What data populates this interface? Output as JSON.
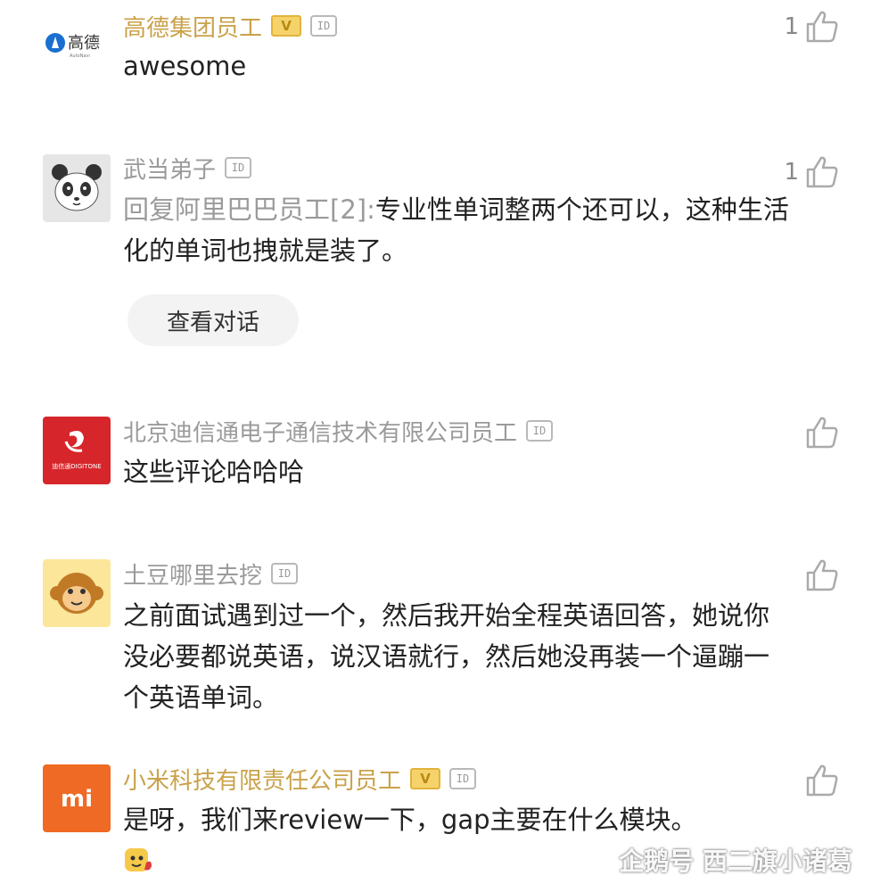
{
  "comments": [
    {
      "username": "高德集团员工",
      "vip_badge": "V",
      "id_badge": "ID",
      "avatar_logo_text": "高德",
      "text": "awesome",
      "likes": "1"
    },
    {
      "username": "武当弟子",
      "id_badge": "ID",
      "reply_prefix": "回复阿里巴巴员工[2]:",
      "text": "专业性单词整两个还可以，这种生活化的单词也拽就是装了。",
      "likes": "1",
      "view_conversation_label": "查看对话"
    },
    {
      "username": "北京迪信通电子通信技术有限公司员工",
      "id_badge": "ID",
      "avatar_logo_text": "迪信通DIGITONE",
      "text": "这些评论哈哈哈"
    },
    {
      "username": "土豆哪里去挖",
      "id_badge": "ID",
      "text": "之前面试遇到过一个，然后我开始全程英语回答，她说你没必要都说英语，说汉语就行，然后她没再装一个逼蹦一个英语单词。"
    },
    {
      "username": "小米科技有限责任公司员工",
      "vip_badge": "V",
      "id_badge": "ID",
      "avatar_logo_text": "mi",
      "text": "是呀，我们来review一下，gap主要在什么模块。"
    }
  ],
  "watermark": "企鹅号 西二旗小诸葛",
  "colors": {
    "username_gray": "#9a9a9a",
    "vip_gold": "#c9a24a",
    "amap_blue": "#1a6fd0",
    "digitone_red": "#d6262b",
    "xiaomi_orange": "#ef6a24",
    "monkey_bg": "#fbe69a"
  }
}
